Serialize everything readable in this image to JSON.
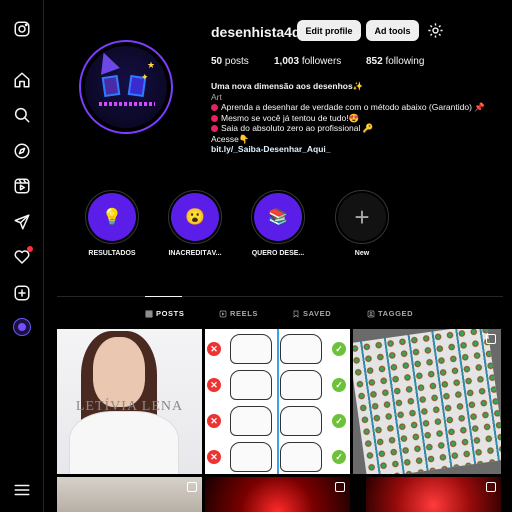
{
  "nav": {
    "items": [
      {
        "name": "instagram-logo-icon"
      },
      {
        "name": "home-icon"
      },
      {
        "name": "search-icon"
      },
      {
        "name": "explore-icon"
      },
      {
        "name": "reels-icon"
      },
      {
        "name": "messages-icon"
      },
      {
        "name": "notifications-icon"
      },
      {
        "name": "create-icon"
      },
      {
        "name": "profile-avatar"
      },
      {
        "name": "menu-icon"
      }
    ]
  },
  "profile": {
    "username": "desenhista4d",
    "edit_label": "Edit profile",
    "ad_tools_label": "Ad tools",
    "posts_count": "50",
    "posts_label": "posts",
    "followers_count": "1,003",
    "followers_label": "followers",
    "following_count": "852",
    "following_label": "following",
    "bio_name": "Uma nova dimensão aos desenhos✨",
    "bio_category": "Art",
    "bio_line1": "Aprenda a desenhar de verdade com o método abaixo (Garantido) 📌",
    "bio_line2": "Mesmo se você já tentou de tudo!😍",
    "bio_line3": "Saia do absoluto zero ao profissional 🔑",
    "bio_line4": "Acesse👇",
    "bio_link": "bit.ly/_Saiba-Desenhar_Aqui_"
  },
  "highlights": [
    {
      "label": "RESULTADOS",
      "emoji": "💡"
    },
    {
      "label": "INACREDITÁV...",
      "emoji": "😮"
    },
    {
      "label": "QUERO DESE...",
      "emoji": "📚"
    },
    {
      "label": "New",
      "emoji": "+"
    }
  ],
  "tabs": {
    "posts": "POSTS",
    "reels": "REELS",
    "saved": "SAVED",
    "tagged": "TAGGED"
  },
  "grid": {
    "post1_watermark": "LETÍVIA LENA"
  },
  "colors": {
    "accent": "#7b3dff",
    "highlight_bg": "#5b1ee8",
    "button_bg": "#efefef",
    "background": "#000000"
  }
}
